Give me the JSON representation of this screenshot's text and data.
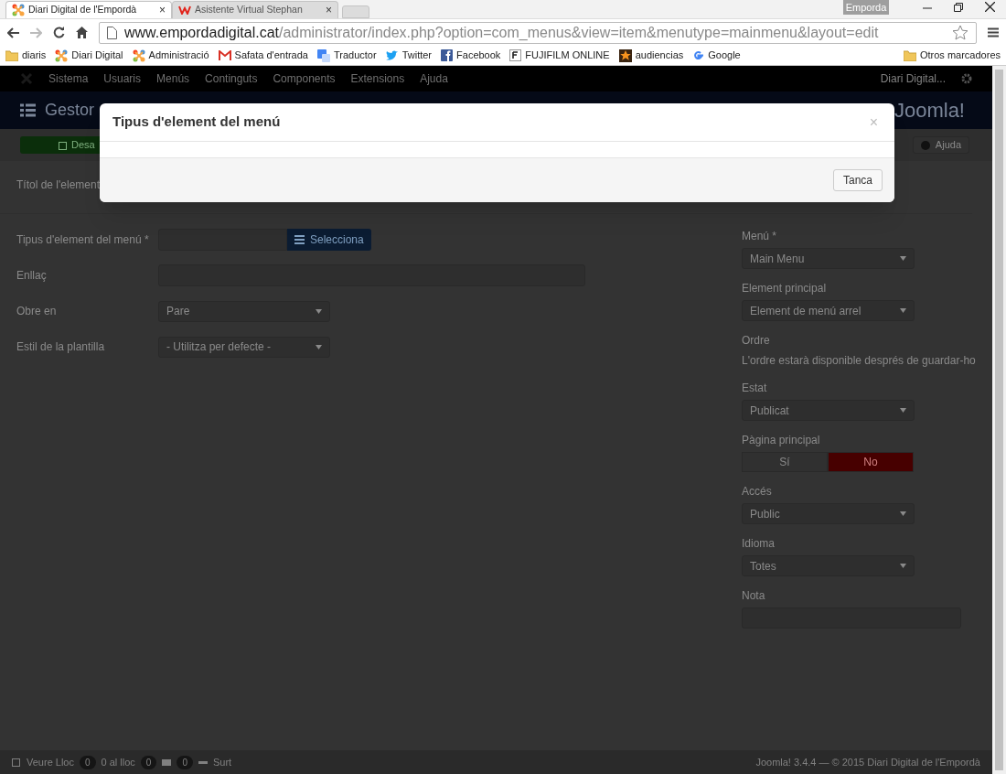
{
  "browser": {
    "tabs": [
      {
        "title": "Diari Digital de l'Empordà",
        "selected": true,
        "close": "×"
      },
      {
        "title": "Asistente Virtual Stephan",
        "selected": false,
        "close": "×"
      }
    ],
    "profile": "Emporda",
    "url": {
      "host": "www.empordadigital.cat",
      "path": "/administrator/index.php?option=com_menus&view=item&menutype=mainmenu&layout=edit"
    },
    "bookmarks": [
      "diaris",
      "Diari Digital",
      "Administració",
      "Safata d'entrada",
      "Traductor",
      "Twitter",
      "Facebook",
      "FUJIFILM ONLINE",
      "audiencias",
      "Google"
    ],
    "other_bookmarks": "Otros marcadores"
  },
  "admin": {
    "nav": [
      "Sistema",
      "Usuaris",
      "Menús",
      "Continguts",
      "Components",
      "Extensions",
      "Ajuda"
    ],
    "site_link": "Diari Digital...",
    "header_title": "Gestor",
    "brand": "Joomla!",
    "save": "Desa",
    "help": "Ajuda",
    "title_label": "Títol de l'element",
    "left_fields": [
      {
        "label": "Tipus d'element del menú *",
        "kind": "select-button",
        "button": "Selecciona"
      },
      {
        "label": "Enllaç",
        "kind": "text"
      },
      {
        "label": "Obre en",
        "kind": "select",
        "value": "Pare"
      },
      {
        "label": "Estil de la plantilla",
        "kind": "select",
        "value": "- Utilitza per defecte -"
      }
    ],
    "right_fields": [
      {
        "label": "Menú *",
        "kind": "select",
        "value": "Main Menu"
      },
      {
        "label": "Element principal",
        "kind": "select",
        "value": "Element de menú arrel"
      },
      {
        "label": "Ordre",
        "kind": "info",
        "value": "L'ordre estarà disponible després de guardar-ho"
      },
      {
        "label": "Estat",
        "kind": "select",
        "value": "Publicat"
      },
      {
        "label": "Pàgina principal",
        "kind": "toggle",
        "options": [
          {
            "label": "Sí",
            "selected": false
          },
          {
            "label": "No",
            "selected": true
          }
        ]
      },
      {
        "label": "Accés",
        "kind": "select",
        "value": "Public"
      },
      {
        "label": "Idioma",
        "kind": "select",
        "value": "Totes"
      },
      {
        "label": "Nota",
        "kind": "text"
      }
    ],
    "footer": {
      "view_site": "Veure Lloc",
      "visitors": "0",
      "visitors_label": "0 al lloc",
      "admins": "0",
      "messages": "0",
      "logout": "Surt",
      "version": "Joomla! 3.4.4 — © 2015 Diari Digital de l'Empordà"
    }
  },
  "modal": {
    "title": "Tipus d'element del menú",
    "close": "×",
    "button": "Tanca"
  }
}
